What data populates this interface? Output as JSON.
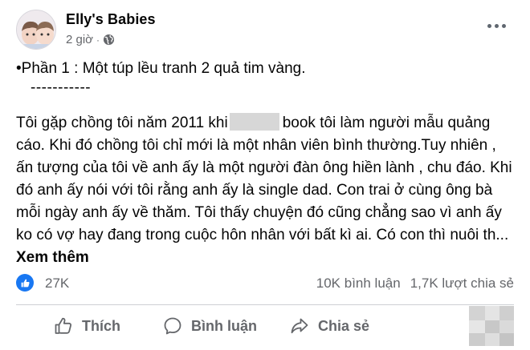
{
  "post": {
    "page_name": "Elly's Babies",
    "time": "2 giờ",
    "separator": "·",
    "part_title": "•Phần 1 : Một túp lều tranh 2 quả tim vàng.",
    "divider": "-----------",
    "story_before_censor": "Tôi gặp chồng tôi năm 2011 khi",
    "story_after_censor": "book tôi làm người mẫu quảng cáo. Khi đó chồng tôi chỉ mới là một nhân viên bình thường.Tuy nhiên , ấn tượng của tôi về anh ấy là một người đàn ông hiền lành , chu đáo. Khi đó anh ấy nói với tôi rằng anh ấy là single dad. Con trai ở cùng ông bà mỗi ngày anh ấy về thăm. Tôi thấy chuyện đó cũng chẳng sao vì anh ấy ko có vợ hay đang trong cuộc hôn nhân với bất kì ai. Có con thì nuôi th...",
    "see_more": "Xem thêm"
  },
  "stats": {
    "reactions": "27K",
    "comments": "10K bình luận",
    "shares": "1,7K lượt chia sẻ"
  },
  "actions": {
    "like": "Thích",
    "comment": "Bình luận",
    "share": "Chia sẻ"
  },
  "colors": {
    "accent": "#1877f2",
    "secondary_text": "#65676b",
    "primary_text": "#050505"
  },
  "icons": [
    "globe-icon",
    "more-icon",
    "like-icon",
    "comment-icon",
    "share-icon"
  ]
}
